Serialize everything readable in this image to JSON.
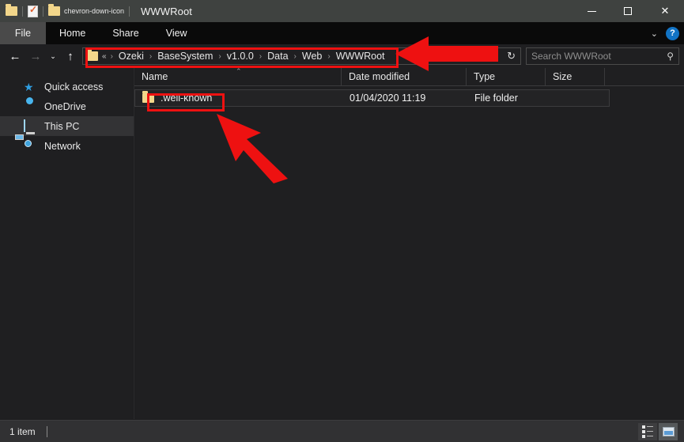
{
  "window": {
    "title": "WWWRoot",
    "icons": [
      "folder-icon",
      "document-check-icon",
      "folder-icon",
      "chevron-down-icon"
    ],
    "controls": {
      "minimize": "–",
      "maximize": "□",
      "close": "✕"
    }
  },
  "ribbon": {
    "tabs": [
      {
        "label": "File",
        "active": true
      },
      {
        "label": "Home",
        "active": false
      },
      {
        "label": "Share",
        "active": false
      },
      {
        "label": "View",
        "active": false
      }
    ],
    "expand_icon": "⌄",
    "help_label": "?"
  },
  "navigation": {
    "back": "←",
    "forward": "→",
    "recent_dropdown": "⌄",
    "up": "↑",
    "refresh": "↻",
    "history_chevron": "⌄"
  },
  "address": {
    "root_prefix": "«",
    "crumbs": [
      "Ozeki",
      "BaseSystem",
      "v1.0.0",
      "Data",
      "Web",
      "WWWRoot"
    ],
    "separator": "›"
  },
  "search": {
    "placeholder": "Search WWWRoot",
    "icon": "search-icon"
  },
  "sidebar": {
    "items": [
      {
        "label": "Quick access",
        "icon": "star-icon",
        "selected": false
      },
      {
        "label": "OneDrive",
        "icon": "cloud-icon",
        "selected": false
      },
      {
        "label": "This PC",
        "icon": "monitor-icon",
        "selected": true
      },
      {
        "label": "Network",
        "icon": "network-icon",
        "selected": false
      }
    ]
  },
  "file_list": {
    "columns": [
      "Name",
      "Date modified",
      "Type",
      "Size"
    ],
    "sort_indicator": "⌃",
    "rows": [
      {
        "name": ".well-known",
        "date_modified": "01/04/2020 11:19",
        "type": "File folder",
        "size": "",
        "icon": "folder-icon"
      }
    ]
  },
  "status": {
    "item_count": "1 item",
    "view_buttons": [
      {
        "name": "details-view-button",
        "active": false
      },
      {
        "name": "large-icons-view-button",
        "active": true
      }
    ]
  },
  "annotations": {
    "highlight_color": "#ee1111",
    "address_bar_box": "red-rectangle-address-bar",
    "file_row_box": "red-rectangle-file-row",
    "arrow_to_address": "red-arrow-left",
    "arrow_to_file": "red-arrow-up-left"
  }
}
